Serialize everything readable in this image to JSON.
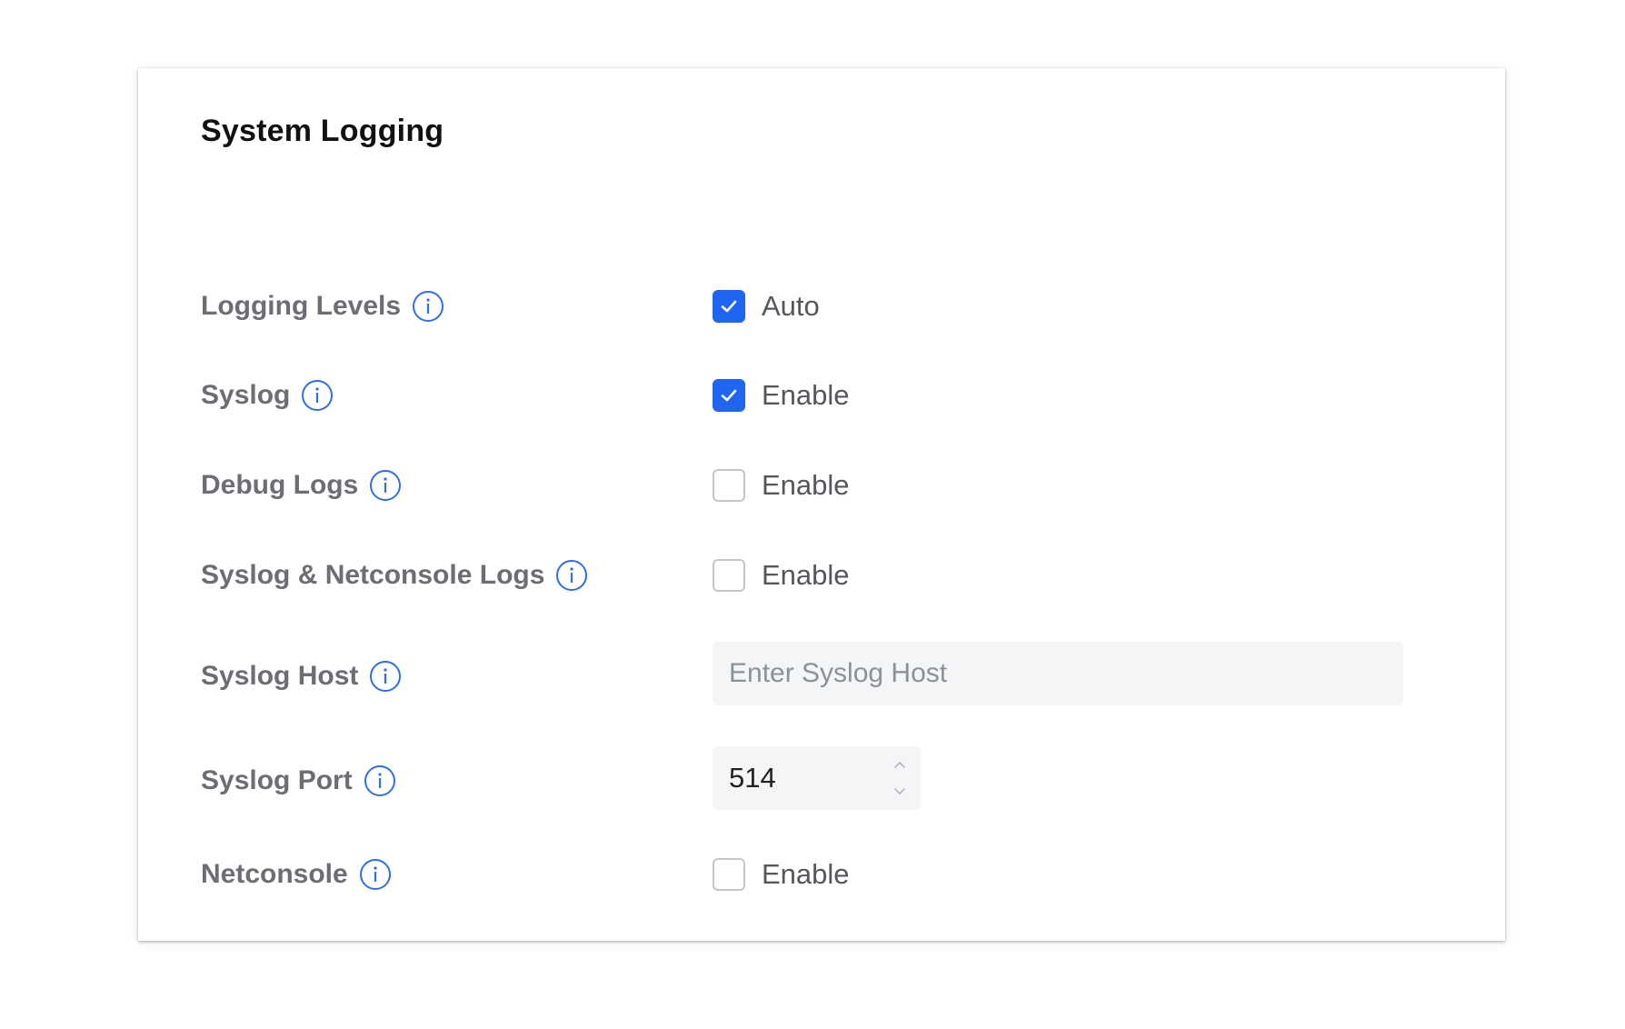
{
  "card": {
    "title": "System Logging"
  },
  "rows": [
    {
      "label": "Logging Levels",
      "control": "checkbox",
      "checked": true,
      "text": "Auto"
    },
    {
      "label": "Syslog",
      "control": "checkbox",
      "checked": true,
      "text": "Enable"
    },
    {
      "label": "Debug Logs",
      "control": "checkbox",
      "checked": false,
      "text": "Enable"
    },
    {
      "label": "Syslog & Netconsole Logs",
      "control": "checkbox",
      "checked": false,
      "text": "Enable"
    },
    {
      "label": "Syslog Host",
      "control": "text-input",
      "value": "",
      "placeholder": "Enter Syslog Host"
    },
    {
      "label": "Syslog Port",
      "control": "number-input",
      "value": "514"
    },
    {
      "label": "Netconsole",
      "control": "checkbox",
      "checked": false,
      "text": "Enable"
    }
  ],
  "icons": {
    "info": "info-icon",
    "check": "check-icon",
    "stepper_up": "chevron-up-icon",
    "stepper_down": "chevron-down-icon"
  },
  "colors": {
    "accent": "#1f65f2",
    "label": "#6c6e74",
    "checkbox_border": "#c4c6cc",
    "input_bg": "#f4f5f7"
  }
}
